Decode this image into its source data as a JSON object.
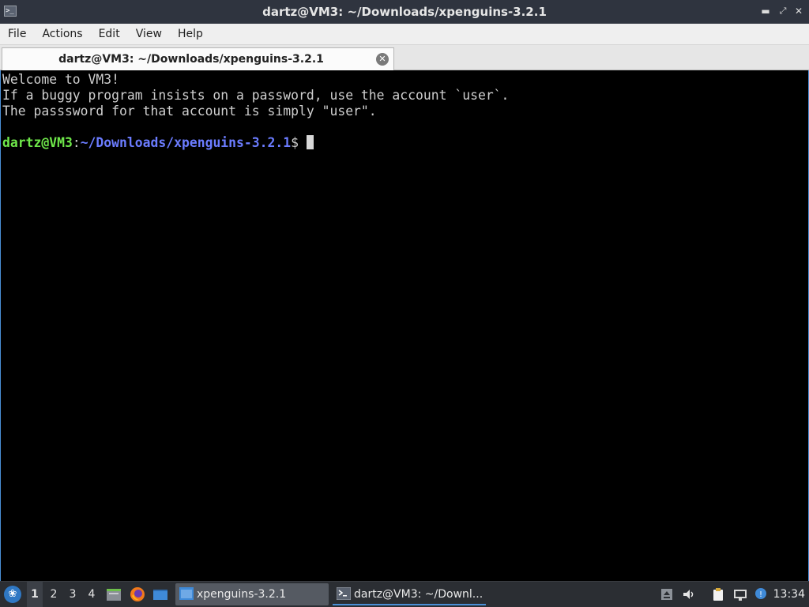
{
  "window": {
    "title": "dartz@VM3: ~/Downloads/xpenguins-3.2.1",
    "app_icon": "terminal-icon",
    "controls": {
      "minimize": "minimize-icon",
      "maximize": "maximize-icon",
      "close": "close-icon"
    }
  },
  "menu": [
    "File",
    "Actions",
    "Edit",
    "View",
    "Help"
  ],
  "tab": {
    "label": "dartz@VM3: ~/Downloads/xpenguins-3.2.1",
    "close_icon": "close-icon"
  },
  "terminal": {
    "lines": [
      "Welcome to VM3!",
      "If a buggy program insists on a password, use the account `user`.",
      "The passsword for that account is simply \"user\"."
    ],
    "prompt": {
      "user_host": "dartz@VM3",
      "separator": ":",
      "path": "~/Downloads/xpenguins-3.2.1",
      "symbol": "$"
    },
    "colors": {
      "user": "#6fe84a",
      "path": "#6b7cff",
      "text": "#cfcfcf"
    }
  },
  "taskbar": {
    "start_icon": "start-menu-icon",
    "workspaces": [
      "1",
      "2",
      "3",
      "4"
    ],
    "active_workspace": "1",
    "quicklaunch": [
      "file-manager-icon",
      "firefox-icon",
      "desktop-icon"
    ],
    "tasks": [
      {
        "label": "xpenguins-3.2.1",
        "icon": "folder-window-icon"
      },
      {
        "label": "dartz@VM3: ~/Downl...",
        "icon": "terminal-icon"
      }
    ],
    "tray": [
      "removable-media-icon",
      "volume-icon",
      "clipboard-icon",
      "network-icon",
      "notification-icon"
    ],
    "clock": "13:34"
  }
}
